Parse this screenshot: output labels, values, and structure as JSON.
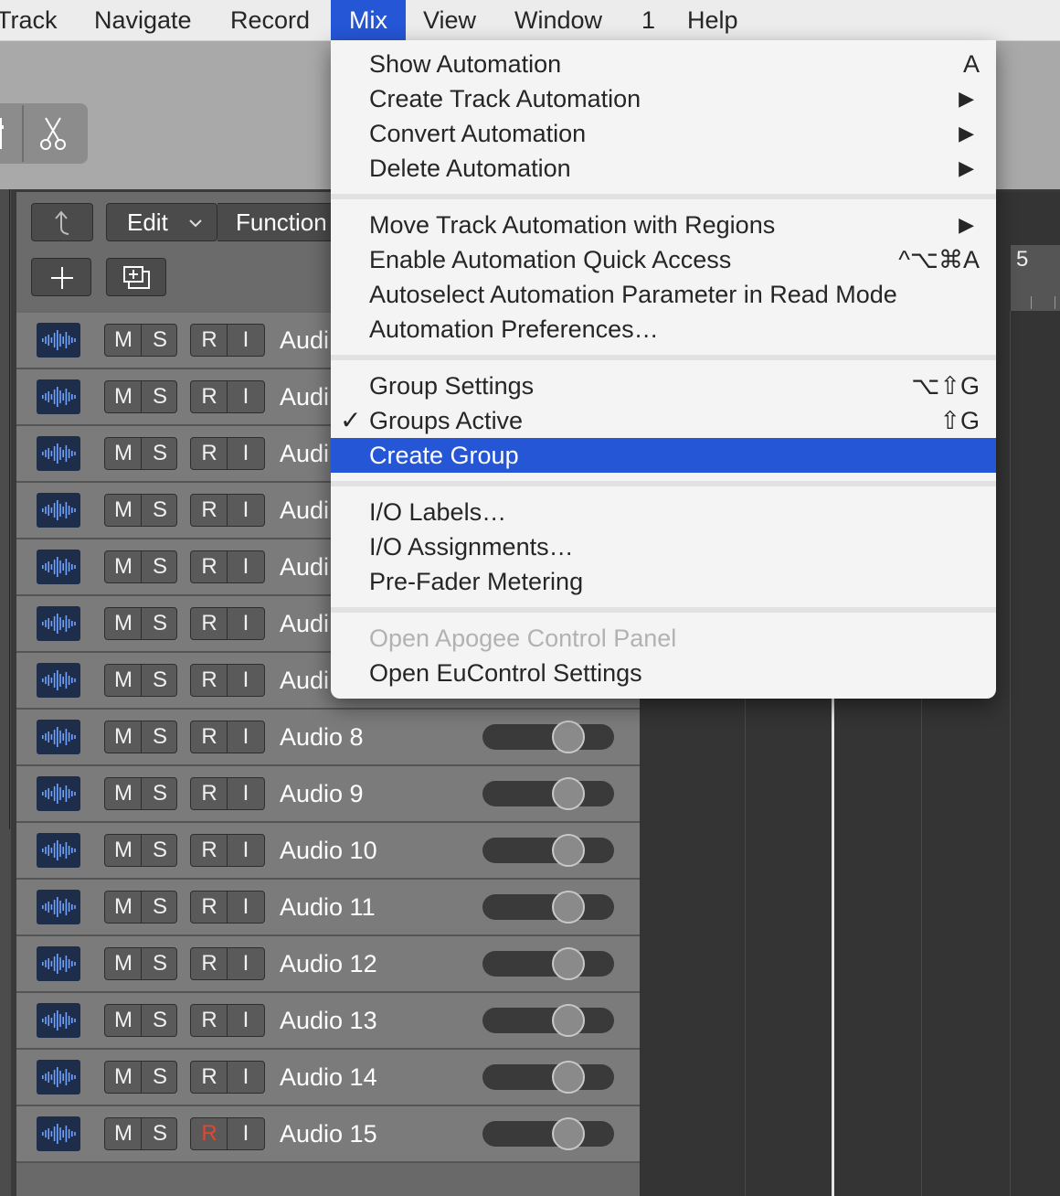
{
  "menubar": {
    "items": [
      "Track",
      "Navigate",
      "Record",
      "Mix",
      "View",
      "Window",
      "1",
      "Help"
    ],
    "active": "Mix"
  },
  "toolbar": {
    "edit_label": "Edit",
    "functions_label": "Function"
  },
  "ruler": {
    "bar_number": "5"
  },
  "tracks": [
    {
      "name": "Audio 8",
      "mute": "M",
      "solo": "S",
      "record": "R",
      "input": "I",
      "volume": 0.7
    },
    {
      "name": "Audio 9",
      "mute": "M",
      "solo": "S",
      "record": "R",
      "input": "I",
      "volume": 0.7
    },
    {
      "name": "Audio 10",
      "mute": "M",
      "solo": "S",
      "record": "R",
      "input": "I",
      "volume": 0.7
    },
    {
      "name": "Audio 11",
      "mute": "M",
      "solo": "S",
      "record": "R",
      "input": "I",
      "volume": 0.7
    },
    {
      "name": "Audio 12",
      "mute": "M",
      "solo": "S",
      "record": "R",
      "input": "I",
      "volume": 0.7
    },
    {
      "name": "Audio 13",
      "mute": "M",
      "solo": "S",
      "record": "R",
      "input": "I",
      "volume": 0.7
    },
    {
      "name": "Audio 14",
      "mute": "M",
      "solo": "S",
      "record": "R",
      "input": "I",
      "volume": 0.7
    },
    {
      "name": "Audio 15",
      "mute": "M",
      "solo": "S",
      "record": "R",
      "input": "I",
      "volume": 0.7,
      "record_armed": true
    }
  ],
  "hidden_tracks": [
    {
      "name": "Audi",
      "mute": "M",
      "solo": "S",
      "record": "R",
      "input": "I"
    },
    {
      "name": "Audi",
      "mute": "M",
      "solo": "S",
      "record": "R",
      "input": "I"
    },
    {
      "name": "Audi",
      "mute": "M",
      "solo": "S",
      "record": "R",
      "input": "I"
    },
    {
      "name": "Audi",
      "mute": "M",
      "solo": "S",
      "record": "R",
      "input": "I"
    },
    {
      "name": "Audi",
      "mute": "M",
      "solo": "S",
      "record": "R",
      "input": "I"
    },
    {
      "name": "Audi",
      "mute": "M",
      "solo": "S",
      "record": "R",
      "input": "I"
    },
    {
      "name": "Audi",
      "mute": "M",
      "solo": "S",
      "record": "R",
      "input": "I"
    }
  ],
  "mix_menu": {
    "groups": [
      [
        {
          "label": "Show Automation",
          "shortcut": "A"
        },
        {
          "label": "Create Track Automation",
          "submenu": "▶"
        },
        {
          "label": "Convert Automation",
          "submenu": "▶"
        },
        {
          "label": "Delete Automation",
          "submenu": "▶"
        }
      ],
      [
        {
          "label": "Move Track Automation with Regions",
          "submenu": "▶"
        },
        {
          "label": "Enable Automation Quick Access",
          "shortcut": "^⌥⌘A"
        },
        {
          "label": "Autoselect Automation Parameter in Read Mode"
        },
        {
          "label": "Automation Preferences…"
        }
      ],
      [
        {
          "label": "Group Settings",
          "shortcut": "⌥⇧G"
        },
        {
          "label": "Groups Active",
          "shortcut": "⇧G",
          "checked": "✓"
        },
        {
          "label": "Create Group",
          "highlighted": true
        }
      ],
      [
        {
          "label": "I/O Labels…"
        },
        {
          "label": "I/O Assignments…"
        },
        {
          "label": "Pre-Fader Metering"
        }
      ],
      [
        {
          "label": "Open Apogee Control Panel",
          "disabled": true
        },
        {
          "label": "Open EuControl Settings"
        }
      ]
    ]
  },
  "colors": {
    "menu_highlight": "#2556d6",
    "record_armed": "#e2472f"
  }
}
